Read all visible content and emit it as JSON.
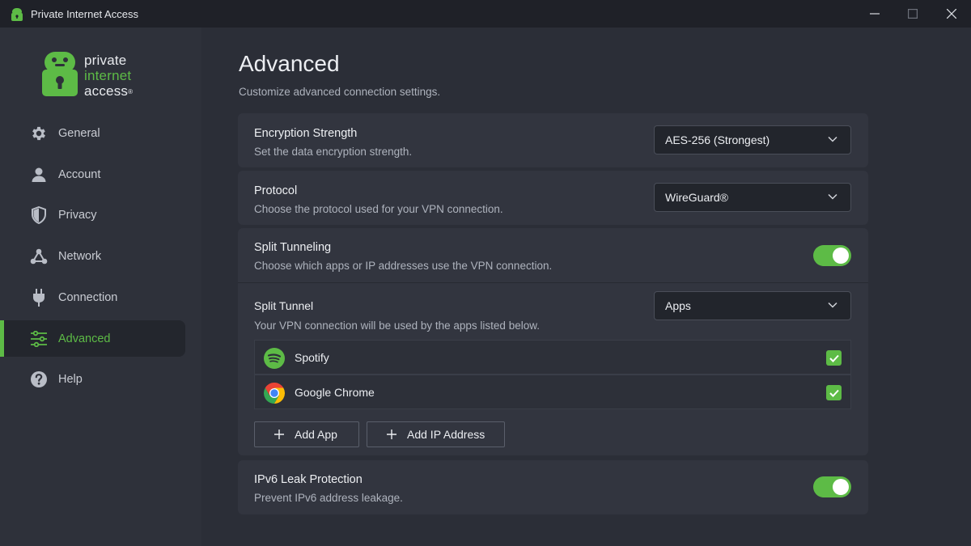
{
  "window": {
    "title": "Private Internet Access"
  },
  "logo": {
    "line1": "private",
    "line2": "internet",
    "line3": "access",
    "registered": "®"
  },
  "sidebar": {
    "items": [
      {
        "label": "General",
        "icon": "gear-icon"
      },
      {
        "label": "Account",
        "icon": "person-icon"
      },
      {
        "label": "Privacy",
        "icon": "shield-icon"
      },
      {
        "label": "Network",
        "icon": "network-icon"
      },
      {
        "label": "Connection",
        "icon": "plug-icon"
      },
      {
        "label": "Advanced",
        "icon": "sliders-icon",
        "active": true
      },
      {
        "label": "Help",
        "icon": "help-icon"
      }
    ]
  },
  "main": {
    "title": "Advanced",
    "subtitle": "Customize advanced connection settings.",
    "encryption": {
      "title": "Encryption Strength",
      "desc": "Set the data encryption strength.",
      "value": "AES-256 (Strongest)"
    },
    "protocol": {
      "title": "Protocol",
      "desc": "Choose the protocol used for your VPN connection.",
      "value": "WireGuard®"
    },
    "split_tunneling": {
      "title": "Split Tunneling",
      "desc": "Choose which apps or IP addresses use the VPN connection.",
      "enabled": true,
      "split_tunnel": {
        "title": "Split Tunnel",
        "desc": "Your VPN connection will be used by the apps listed below.",
        "value": "Apps"
      },
      "apps": [
        {
          "name": "Spotify",
          "checked": true,
          "icon": "spotify-icon"
        },
        {
          "name": "Google Chrome",
          "checked": true,
          "icon": "chrome-icon"
        }
      ],
      "add_app_label": "Add App",
      "add_ip_label": "Add IP Address"
    },
    "ipv6": {
      "title": "IPv6 Leak Protection",
      "desc": "Prevent IPv6 address leakage.",
      "enabled": true
    }
  },
  "colors": {
    "accent": "#5dbb46",
    "background": "#2b2e37",
    "sidebar": "#2e313a",
    "card": "#32353f",
    "titlebar": "#1f2128"
  }
}
